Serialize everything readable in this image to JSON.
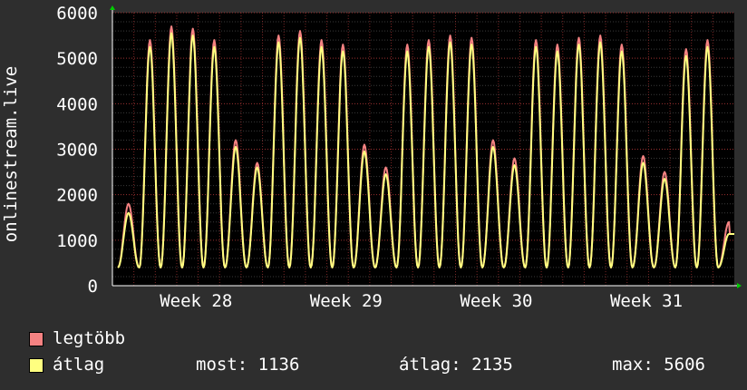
{
  "colors": {
    "background": "#2e2e2e",
    "plot_bg": "#000000",
    "max_color": "#f58282",
    "avg_color": "#ffff80",
    "grid_major": "#9a3030",
    "grid_minor": "#3a3a3a"
  },
  "legend": {
    "max_label": "legtöbb",
    "avg_label": "átlag",
    "now_text": "most: 1136",
    "avg_text": "átlag: 2135",
    "max_text": "max: 5606"
  },
  "chart_data": {
    "type": "line",
    "ylabel": "onlinestream.live",
    "ylim": [
      0,
      6000
    ],
    "yticks": [
      0,
      1000,
      2000,
      3000,
      4000,
      5000,
      6000
    ],
    "x_tick_labels": [
      "Week 28",
      "Week 29",
      "Week 30",
      "Week 31"
    ],
    "days": 29,
    "series": [
      {
        "name": "legtöbb",
        "daily_peaks": [
          1800,
          5400,
          5700,
          5650,
          5400,
          3200,
          2700,
          5500,
          5600,
          5400,
          5300,
          3100,
          2600,
          5300,
          5400,
          5500,
          5450,
          3200,
          2800,
          5400,
          5300,
          5450,
          5500,
          5300,
          2850,
          2500,
          5200,
          5400,
          1400
        ]
      },
      {
        "name": "átlag",
        "daily_peaks": [
          1600,
          5250,
          5550,
          5500,
          5250,
          3050,
          2600,
          5350,
          5450,
          5250,
          5150,
          2950,
          2450,
          5150,
          5250,
          5350,
          5300,
          3050,
          2650,
          5250,
          5150,
          5300,
          5350,
          5150,
          2700,
          2350,
          5050,
          5250,
          1136
        ]
      }
    ],
    "daily_min": 400,
    "last_value": 1136
  }
}
